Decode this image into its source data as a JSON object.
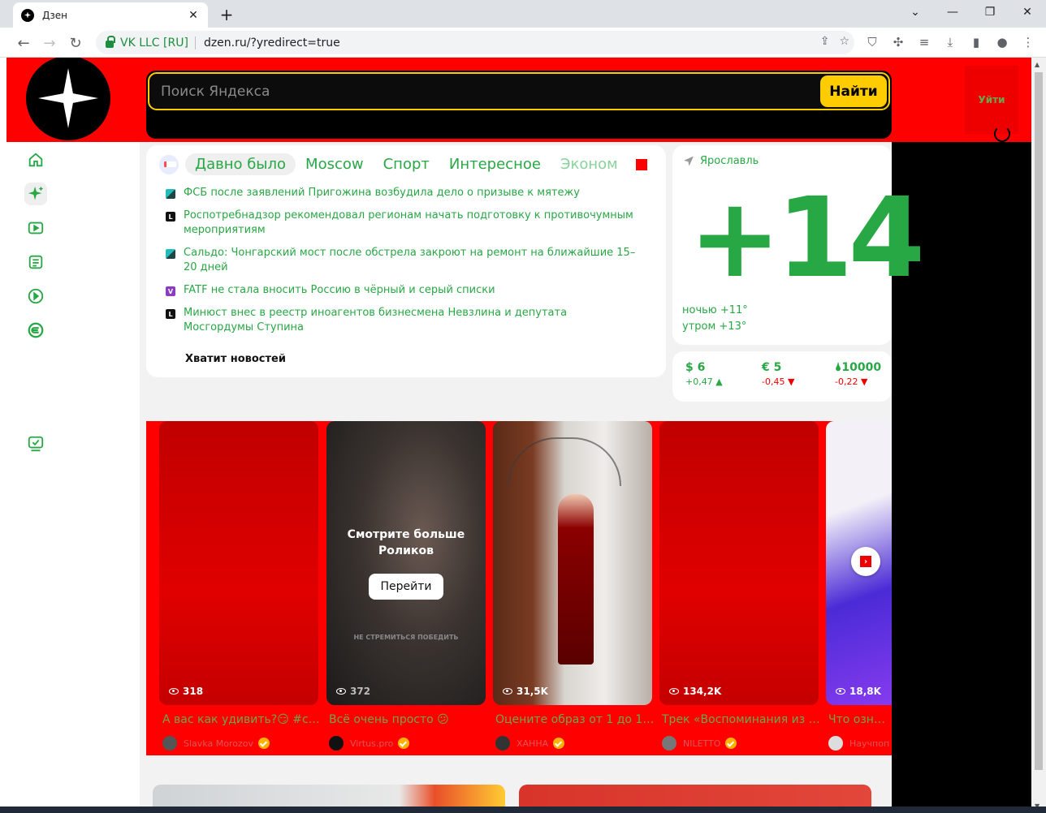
{
  "browser": {
    "tab_title": "Дзен",
    "tab_close": "✕",
    "new_tab": "+",
    "site_identity": "VK LLC [RU]",
    "url": "dzen.ru/?yredirect=true"
  },
  "header": {
    "search_placeholder": "Поиск Яндекса",
    "search_button": "Найти",
    "login": "Уйти"
  },
  "sidebar": {
    "items": [
      "home-icon",
      "sparkle-icon",
      "video-icon",
      "articles-icon",
      "clips-icon",
      "subscriptions-icon",
      "tv-icon"
    ]
  },
  "news": {
    "tabs": [
      "Давно было",
      "Moscow",
      "Спорт",
      "Интересное",
      "Эконом"
    ],
    "items": [
      {
        "source": "tass",
        "badge": "",
        "text": "ФСБ после заявлений Пригожина возбудила дело о призыве к мятежу"
      },
      {
        "source": "lenta",
        "badge": "L",
        "text": "Роспотребнадзор рекомендовал регионам начать подготовку к противочумным мероприятиям"
      },
      {
        "source": "tass",
        "badge": "",
        "text": "Сальдо: Чонгарский мост после обстрела закроют на ремонт на ближайшие 15–20 дней"
      },
      {
        "source": "v",
        "badge": "V",
        "text": "FATF не стала вносить Россию в чёрный и серый списки"
      },
      {
        "source": "lenta",
        "badge": "L",
        "text": "Минюст внес в реестр иноагентов бизнесмена Невзлина и депутата Мосгордумы Ступина"
      }
    ],
    "enough": "Хватит новостей"
  },
  "weather": {
    "city": "Ярославль",
    "temp": "+14",
    "night": "ночью +11°",
    "morning": "утром +13°"
  },
  "rates": [
    {
      "value": "$ 6",
      "change": "+0,47 ▲",
      "dir": "up"
    },
    {
      "value": "€ 5",
      "change": "-0,45 ▼",
      "dir": "down"
    },
    {
      "value": "🌢10000",
      "change": "-0,22 ▼",
      "dir": "down"
    }
  ],
  "shorts": {
    "more_title": "Смотрите больше Роликов",
    "more_button": "Перейти",
    "slogan": "НЕ СТРЕМИТЬСЯ ПОБЕДИТЬ",
    "next": "›",
    "cards": [
      {
        "views": "318",
        "title": "А вас как удивить?😏 #сл...",
        "author": "Slavka Morozov"
      },
      {
        "views": "372",
        "title": "Всё очень просто 😕",
        "author": "Virtus.pro"
      },
      {
        "views": "31,5K",
        "title": "Оцените образ от 1 до 10...",
        "author": "ХАННА"
      },
      {
        "views": "134,2K",
        "title": "Трек «Воспоминания из Е...",
        "author": "NILETTO"
      },
      {
        "views": "18,8K",
        "title": "Что означа",
        "author": "Научпоп"
      }
    ]
  },
  "colors": {
    "accent": "#28a745",
    "brand_red": "#ff0000",
    "search_yellow": "#ffcc00"
  }
}
